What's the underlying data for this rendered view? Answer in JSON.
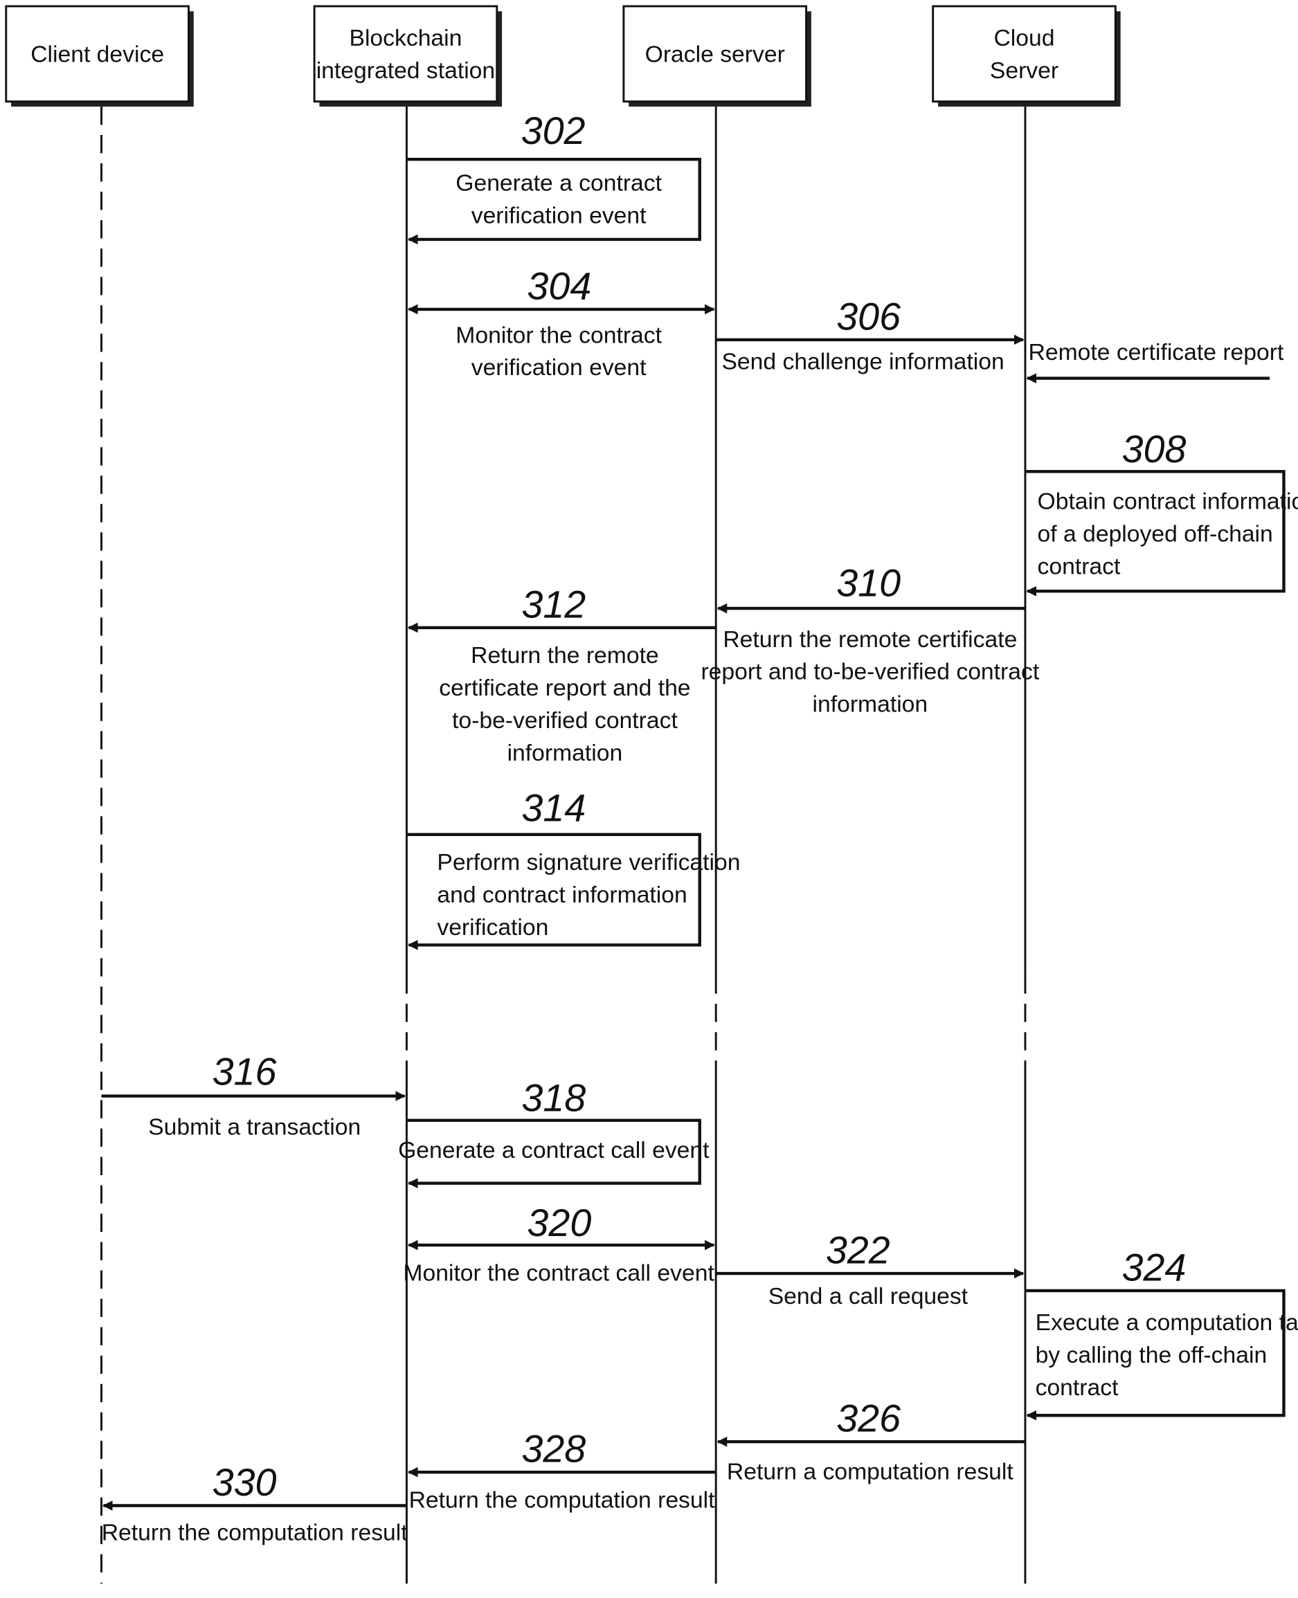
{
  "participants": [
    {
      "id": "client",
      "lines": [
        "Client device"
      ]
    },
    {
      "id": "blockchain",
      "lines": [
        "Blockchain",
        "integrated station"
      ]
    },
    {
      "id": "oracle",
      "lines": [
        "Oracle server"
      ]
    },
    {
      "id": "cloud",
      "lines": [
        "Cloud",
        "Server"
      ]
    }
  ],
  "steps": [
    {
      "num": "302",
      "type": "self",
      "actor": "blockchain",
      "lines": [
        "Generate a contract",
        "verification event"
      ]
    },
    {
      "num": "304",
      "type": "bidir",
      "from": "blockchain",
      "to": "oracle",
      "lines": [
        "Monitor the contract",
        "verification event"
      ]
    },
    {
      "num": "306",
      "type": "msg",
      "from": "oracle",
      "to": "cloud",
      "lines": [
        "Send challenge information"
      ]
    },
    {
      "num": "",
      "type": "external",
      "to": "cloud",
      "lines": [
        "Remote certificate report"
      ]
    },
    {
      "num": "308",
      "type": "self",
      "actor": "cloud",
      "lines": [
        "Obtain contract information",
        "of a deployed off-chain",
        "contract"
      ]
    },
    {
      "num": "310",
      "type": "msg",
      "from": "cloud",
      "to": "oracle",
      "lines": [
        "Return the remote certificate",
        "report and to-be-verified contract",
        "information"
      ]
    },
    {
      "num": "312",
      "type": "msg",
      "from": "oracle",
      "to": "blockchain",
      "lines": [
        "Return the remote",
        "certificate report and the",
        "to-be-verified contract",
        "information"
      ]
    },
    {
      "num": "314",
      "type": "self",
      "actor": "blockchain",
      "lines": [
        "Perform signature verification",
        "and contract information",
        "verification"
      ]
    },
    {
      "num": "316",
      "type": "msg",
      "from": "client",
      "to": "blockchain",
      "lines": [
        "Submit a transaction"
      ]
    },
    {
      "num": "318",
      "type": "self",
      "actor": "blockchain",
      "lines": [
        "Generate a contract call event"
      ]
    },
    {
      "num": "320",
      "type": "bidir",
      "from": "blockchain",
      "to": "oracle",
      "lines": [
        "Monitor the contract call event"
      ]
    },
    {
      "num": "322",
      "type": "msg",
      "from": "oracle",
      "to": "cloud",
      "lines": [
        "Send a call request"
      ]
    },
    {
      "num": "324",
      "type": "self",
      "actor": "cloud",
      "lines": [
        "Execute a computation task",
        "by calling the off-chain",
        "contract"
      ]
    },
    {
      "num": "326",
      "type": "msg",
      "from": "cloud",
      "to": "oracle",
      "lines": [
        "Return a computation result"
      ]
    },
    {
      "num": "328",
      "type": "msg",
      "from": "oracle",
      "to": "blockchain",
      "lines": [
        "Return the computation result"
      ]
    },
    {
      "num": "330",
      "type": "msg",
      "from": "blockchain",
      "to": "client",
      "lines": [
        "Return the computation result"
      ]
    }
  ]
}
